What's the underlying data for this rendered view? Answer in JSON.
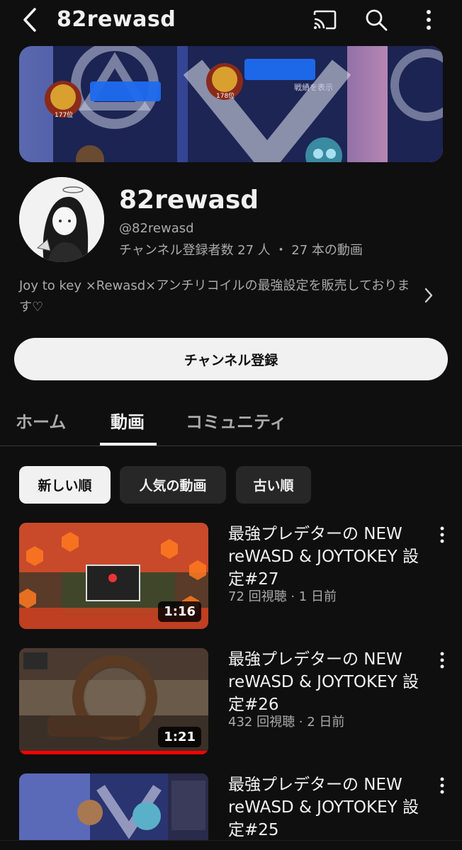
{
  "header": {
    "title": "82rewasd",
    "icons": [
      "back-chevron-icon",
      "cast-icon",
      "search-icon",
      "more-vert-icon"
    ]
  },
  "channel": {
    "name": "82rewasd",
    "handle": "@82rewasd",
    "stats": "チャンネル登録者数 27 人 ・ 27 本の動画",
    "description": "Joy to key ×Rewasd×アンチリコイルの最強設定を販売しております♡",
    "subscribe_label": "チャンネル登録"
  },
  "banner": {
    "rank_left": "177位",
    "rank_right": "178位",
    "text_right": "戦績を表示"
  },
  "tabs": [
    {
      "label": "ホーム",
      "active": false
    },
    {
      "label": "動画",
      "active": true
    },
    {
      "label": "コミュニティ",
      "active": false
    }
  ],
  "chips": [
    {
      "label": "新しい順",
      "selected": true
    },
    {
      "label": "人気の動画",
      "selected": false
    },
    {
      "label": "古い順",
      "selected": false
    }
  ],
  "videos": [
    {
      "title": "最強プレデターの NEW reWASD & JOYTOKEY 設定#27",
      "meta": "72 回視聴 · 1 日前",
      "duration": "1:16",
      "watched_fraction": 0
    },
    {
      "title": "最強プレデターの NEW reWASD & JOYTOKEY 設定#26",
      "meta": "432 回視聴 · 2 日前",
      "duration": "1:21",
      "watched_fraction": 1.0
    },
    {
      "title": "最強プレデターの NEW reWASD & JOYTOKEY 設定#25",
      "meta": "",
      "duration": "",
      "watched_fraction": 0
    }
  ],
  "colors": {
    "background": "#0f0f0f",
    "text_primary": "#f1f1f1",
    "text_secondary": "#aaaaaa",
    "chip": "#272727",
    "progress": "#ff0000"
  }
}
